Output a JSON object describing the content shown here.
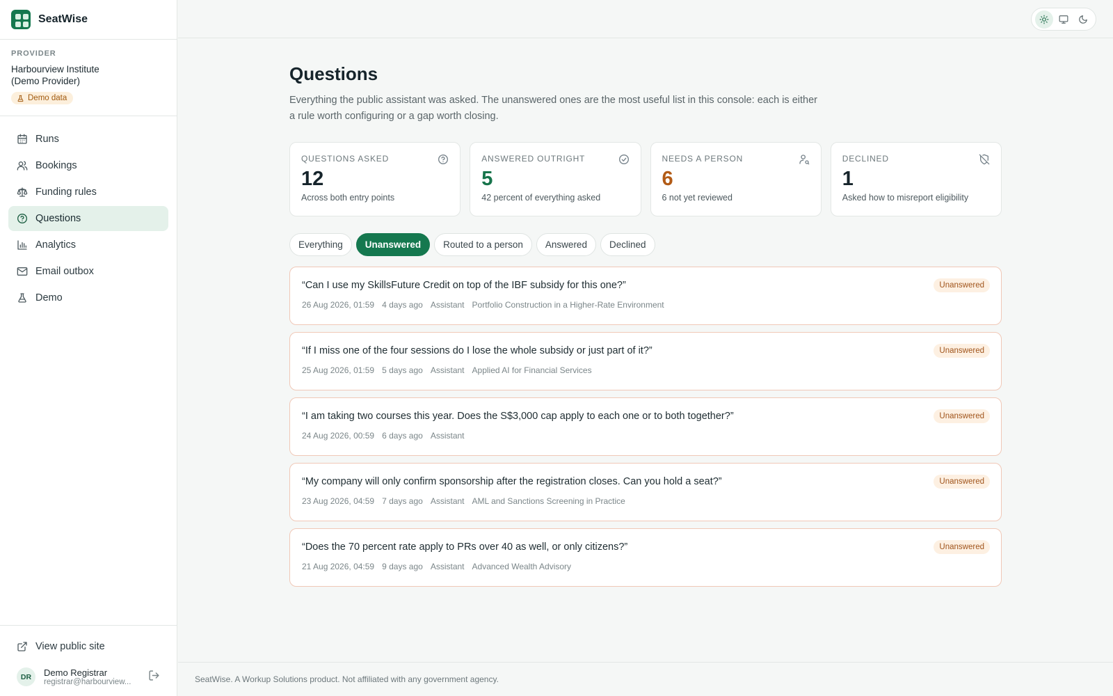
{
  "app": {
    "name": "SeatWise"
  },
  "provider": {
    "label": "PROVIDER",
    "name": "Harbourview Institute (Demo Provider)",
    "badge": "Demo data"
  },
  "sidebar": {
    "items": [
      {
        "label": "Runs",
        "icon": "calendar-icon"
      },
      {
        "label": "Bookings",
        "icon": "users-icon"
      },
      {
        "label": "Funding rules",
        "icon": "scale-icon"
      },
      {
        "label": "Questions",
        "icon": "question-circle-icon",
        "active": true
      },
      {
        "label": "Analytics",
        "icon": "bar-chart-icon"
      },
      {
        "label": "Email outbox",
        "icon": "mail-icon"
      },
      {
        "label": "Demo",
        "icon": "flask-icon"
      }
    ],
    "public_link": "View public site",
    "user": {
      "initials": "DR",
      "name": "Demo Registrar",
      "email": "registrar@harbourview..."
    }
  },
  "page": {
    "title": "Questions",
    "description": "Everything the public assistant was asked. The unanswered ones are the most useful list in this console: each is either a rule worth configuring or a gap worth closing."
  },
  "stats": [
    {
      "label": "QUESTIONS ASKED",
      "value": "12",
      "sub": "Across both entry points",
      "icon": "question-circle-icon",
      "color": "#16242b"
    },
    {
      "label": "ANSWERED OUTRIGHT",
      "value": "5",
      "sub": "42 percent of everything asked",
      "icon": "check-circle-icon",
      "color": "#17744b"
    },
    {
      "label": "NEEDS A PERSON",
      "value": "6",
      "sub": "6 not yet reviewed",
      "icon": "user-search-icon",
      "color": "#b25b16"
    },
    {
      "label": "DECLINED",
      "value": "1",
      "sub": "Asked how to misreport eligibility",
      "icon": "shield-off-icon",
      "color": "#16242b"
    }
  ],
  "filters": [
    {
      "label": "Everything"
    },
    {
      "label": "Unanswered",
      "active": true
    },
    {
      "label": "Routed to a person"
    },
    {
      "label": "Answered"
    },
    {
      "label": "Declined"
    }
  ],
  "questions": [
    {
      "text": "“Can I use my SkillsFuture Credit on top of the IBF subsidy for this one?”",
      "date": "26 Aug 2026, 01:59",
      "ago": "4 days ago",
      "source": "Assistant",
      "course": "Portfolio Construction in a Higher-Rate Environment",
      "status": "Unanswered"
    },
    {
      "text": "“If I miss one of the four sessions do I lose the whole subsidy or just part of it?”",
      "date": "25 Aug 2026, 01:59",
      "ago": "5 days ago",
      "source": "Assistant",
      "course": "Applied AI for Financial Services",
      "status": "Unanswered"
    },
    {
      "text": "“I am taking two courses this year. Does the S$3,000 cap apply to each one or to both together?”",
      "date": "24 Aug 2026, 00:59",
      "ago": "6 days ago",
      "source": "Assistant",
      "course": "",
      "status": "Unanswered"
    },
    {
      "text": "“My company will only confirm sponsorship after the registration closes. Can you hold a seat?”",
      "date": "23 Aug 2026, 04:59",
      "ago": "7 days ago",
      "source": "Assistant",
      "course": "AML and Sanctions Screening in Practice",
      "status": "Unanswered"
    },
    {
      "text": "“Does the 70 percent rate apply to PRs over 40 as well, or only citizens?”",
      "date": "21 Aug 2026, 04:59",
      "ago": "9 days ago",
      "source": "Assistant",
      "course": "Advanced Wealth Advisory",
      "status": "Unanswered"
    }
  ],
  "footer": "SeatWise. A Workup Solutions product. Not affiliated with any government agency."
}
